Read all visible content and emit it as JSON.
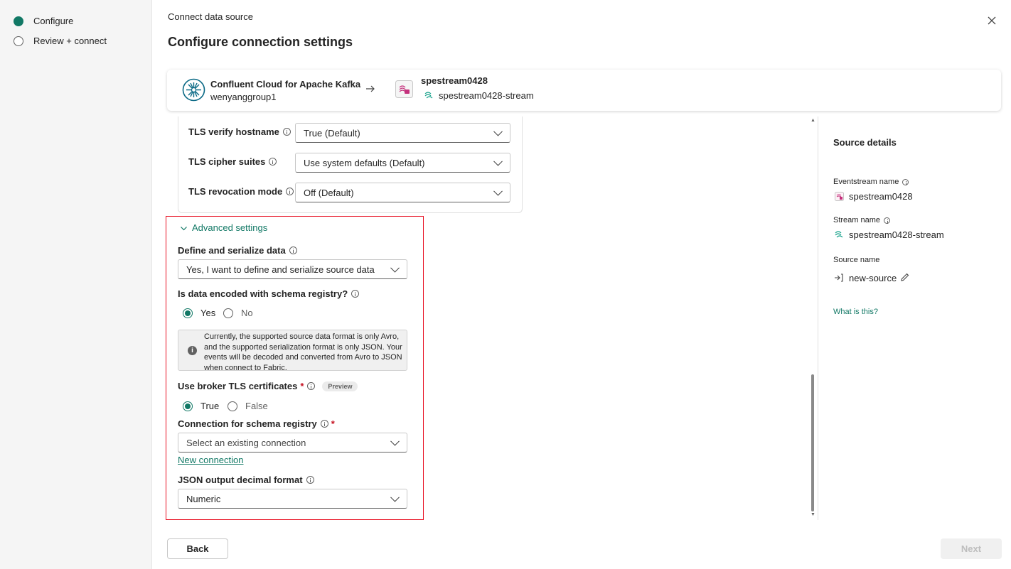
{
  "steps": [
    {
      "label": "Configure",
      "active": true
    },
    {
      "label": "Review + connect",
      "active": false
    }
  ],
  "header": {
    "breadcrumb": "Connect data source",
    "title": "Configure connection settings"
  },
  "connection": {
    "source_name": "Confluent Cloud for Apache Kafka",
    "source_sub": "wenyanggroup1",
    "dest_name": "spestream0428",
    "dest_stream": "spestream0428-stream"
  },
  "tls": {
    "verify_hostname_label": "TLS verify hostname",
    "verify_hostname_value": "True (Default)",
    "cipher_suites_label": "TLS cipher suites",
    "cipher_suites_value": "Use system defaults (Default)",
    "revocation_mode_label": "TLS revocation mode",
    "revocation_mode_value": "Off (Default)"
  },
  "advanced": {
    "toggle_label": "Advanced settings",
    "define_label": "Define and serialize data",
    "define_value": "Yes, I want to define and serialize source data",
    "schema_q_label": "Is data encoded with schema registry?",
    "schema_yes": "Yes",
    "schema_no": "No",
    "info_text": "Currently, the supported source data format is only Avro, and the supported serialization format is only JSON. Your events will be decoded and converted from Avro to JSON when connect to Fabric.",
    "broker_tls_label": "Use broker TLS certificates",
    "required_mark": "*",
    "preview_badge": "Preview",
    "broker_true": "True",
    "broker_false": "False",
    "conn_schema_label": "Connection for schema registry",
    "conn_schema_placeholder": "Select an existing connection",
    "new_connection": "New connection",
    "json_decimal_label": "JSON output decimal format",
    "json_decimal_value": "Numeric"
  },
  "details": {
    "title": "Source details",
    "eventstream_label": "Eventstream name",
    "eventstream_value": "spestream0428",
    "stream_label": "Stream name",
    "stream_value": "spestream0428-stream",
    "source_label": "Source name",
    "source_value": "new-source",
    "what_link": "What is this?"
  },
  "footer": {
    "back": "Back",
    "next": "Next"
  },
  "colors": {
    "accent": "#117865",
    "highlight_border": "#e81123"
  }
}
